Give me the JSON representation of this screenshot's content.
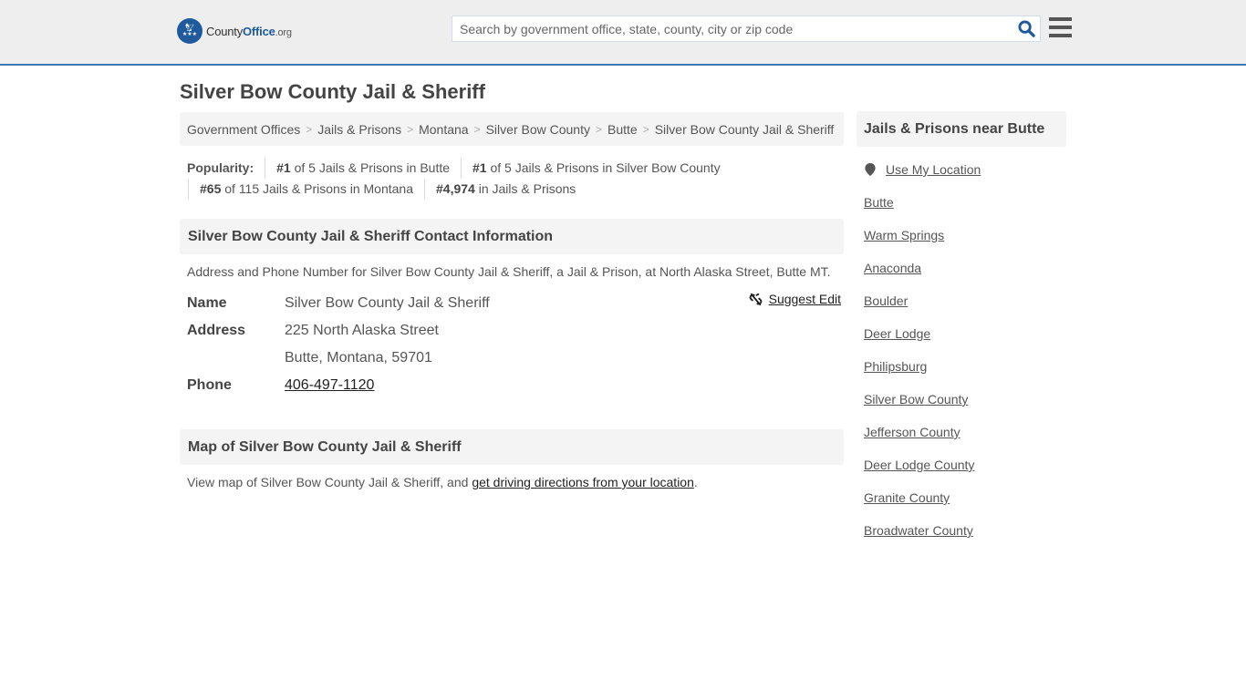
{
  "header": {
    "logo": {
      "brand_part1": "County",
      "brand_part2": "Office",
      "brand_suffix": ".org",
      "icon": "eagle-stars-badge-icon"
    },
    "search": {
      "placeholder": "Search by government office, state, county, city or zip code",
      "value": "",
      "icon": "search-icon"
    },
    "menu_icon": "hamburger-menu-icon"
  },
  "page": {
    "title": "Silver Bow County Jail & Sheriff"
  },
  "breadcrumb": [
    "Government Offices",
    "Jails & Prisons",
    "Montana",
    "Silver Bow County",
    "Butte",
    "Silver Bow County Jail & Sheriff"
  ],
  "popularity": {
    "label": "Popularity:",
    "items": [
      {
        "rank": "#1",
        "text": " of 5 Jails & Prisons in Butte"
      },
      {
        "rank": "#1",
        "text": " of 5 Jails & Prisons in Silver Bow County"
      },
      {
        "rank": "#65",
        "text": " of 115 Jails & Prisons in Montana"
      },
      {
        "rank": "#4,974",
        "text": " in Jails & Prisons"
      }
    ]
  },
  "contact": {
    "heading": "Silver Bow County Jail & Sheriff Contact Information",
    "description": "Address and Phone Number for Silver Bow County Jail & Sheriff, a Jail & Prison, at North Alaska Street, Butte MT.",
    "suggest_edit": "Suggest Edit",
    "name_label": "Name",
    "name_value": "Silver Bow County Jail & Sheriff",
    "address_label": "Address",
    "address_line1": "225 North Alaska Street",
    "address_line2": "Butte, Montana, 59701",
    "phone_label": "Phone",
    "phone_value": "406-497-1120"
  },
  "map": {
    "heading": "Map of Silver Bow County Jail & Sheriff",
    "desc_prefix": "View map of Silver Bow County Jail & Sheriff, and ",
    "desc_link": "get driving directions from your location",
    "desc_suffix": "."
  },
  "sidebar": {
    "heading": "Jails & Prisons near Butte",
    "use_location": "Use My Location",
    "links": [
      "Butte",
      "Warm Springs",
      "Anaconda",
      "Boulder",
      "Deer Lodge",
      "Philipsburg",
      "Silver Bow County",
      "Jefferson County",
      "Deer Lodge County",
      "Granite County",
      "Broadwater County"
    ]
  },
  "colors": {
    "brand_blue": "#1e5a9c",
    "header_border": "#3a78b0",
    "header_bg": "#eeeeee",
    "panel_bg": "#f4f4f4"
  }
}
